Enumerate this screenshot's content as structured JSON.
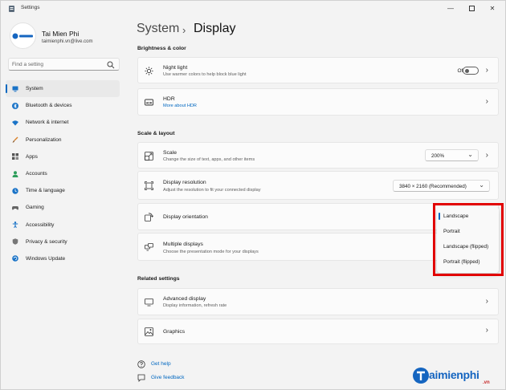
{
  "window": {
    "title": "Settings"
  },
  "profile": {
    "name": "Tai Mien Phi",
    "email": "taimienphi.vn@live.com",
    "avatar_text": "taimienphi"
  },
  "search": {
    "placeholder": "Find a setting"
  },
  "sidebar": {
    "items": [
      {
        "label": "System",
        "icon": "monitor-icon",
        "active": true,
        "color": "#1a73c7"
      },
      {
        "label": "Bluetooth & devices",
        "icon": "bluetooth-icon",
        "color": "#1a73c7"
      },
      {
        "label": "Network & internet",
        "icon": "wifi-icon",
        "color": "#1a73c7"
      },
      {
        "label": "Personalization",
        "icon": "brush-icon",
        "color": "#d9822b"
      },
      {
        "label": "Apps",
        "icon": "apps-icon",
        "color": "#555555"
      },
      {
        "label": "Accounts",
        "icon": "person-icon",
        "color": "#2e9e5b"
      },
      {
        "label": "Time & language",
        "icon": "globe-clock-icon",
        "color": "#1a73c7"
      },
      {
        "label": "Gaming",
        "icon": "gamepad-icon",
        "color": "#666666"
      },
      {
        "label": "Accessibility",
        "icon": "accessibility-icon",
        "color": "#1a73c7"
      },
      {
        "label": "Privacy & security",
        "icon": "shield-icon",
        "color": "#666666"
      },
      {
        "label": "Windows Update",
        "icon": "update-icon",
        "color": "#1a73c7"
      }
    ]
  },
  "breadcrumb": {
    "parent": "System",
    "separator": "›",
    "current": "Display"
  },
  "sections": {
    "brightness": "Brightness & color",
    "scale": "Scale & layout",
    "related": "Related settings"
  },
  "cards": {
    "night_light": {
      "title": "Night light",
      "subtitle": "Use warmer colors to help block blue light",
      "state": "Off"
    },
    "hdr": {
      "title": "HDR",
      "subtitle": "More about HDR"
    },
    "scale": {
      "title": "Scale",
      "subtitle": "Change the size of text, apps, and other items",
      "value": "200%"
    },
    "resolution": {
      "title": "Display resolution",
      "subtitle": "Adjust the resolution to fit your connected display",
      "value": "3840 × 2160 (Recommended)"
    },
    "orientation": {
      "title": "Display orientation"
    },
    "multiple": {
      "title": "Multiple displays",
      "subtitle": "Choose the presentation mode for your displays"
    },
    "advanced": {
      "title": "Advanced display",
      "subtitle": "Display information, refresh rate"
    },
    "graphics": {
      "title": "Graphics"
    }
  },
  "orientation_menu": {
    "options": [
      "Landscape",
      "Portrait",
      "Landscape (flipped)",
      "Portrait (flipped)"
    ],
    "selected": "Landscape",
    "highlight_color": "#e10000"
  },
  "footer": {
    "help": "Get help",
    "feedback": "Give feedback"
  },
  "watermark": {
    "brand": "aimienphi",
    "suffix": ".vn"
  },
  "accent_color": "#0067c0"
}
